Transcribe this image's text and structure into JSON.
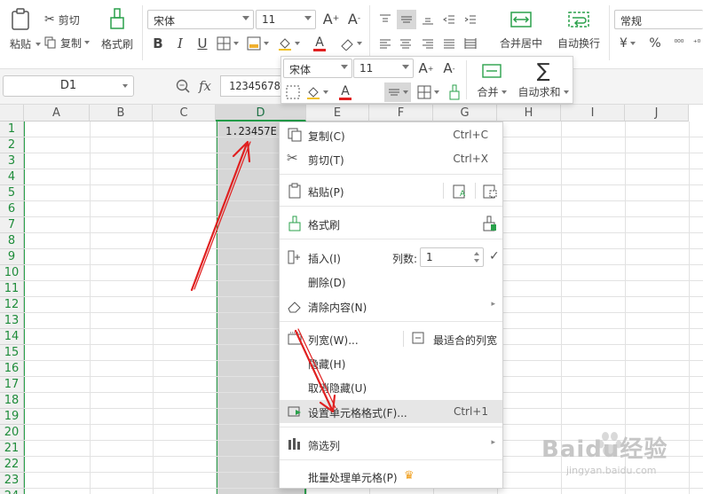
{
  "ribbon": {
    "paste": "粘贴",
    "cut": "剪切",
    "copy": "复制",
    "format_painter": "格式刷",
    "font_name": "宋体",
    "font_size": "11",
    "merge_center": "合并居中",
    "wrap_text": "自动换行",
    "number_format": "常规",
    "currency_symbol": "¥",
    "percent_symbol": "%"
  },
  "formula_bar": {
    "name_box": "D1",
    "fx": "fx",
    "value": "12345678"
  },
  "grid": {
    "columns": [
      "A",
      "B",
      "C",
      "D",
      "E",
      "F",
      "G",
      "H",
      "I",
      "J"
    ],
    "rows": [
      "1",
      "2",
      "3",
      "4",
      "5",
      "6",
      "7",
      "8",
      "9",
      "10",
      "11",
      "12",
      "13",
      "14",
      "15",
      "16",
      "17",
      "18",
      "19",
      "20",
      "21",
      "22",
      "23",
      "24"
    ],
    "active_column": "D",
    "cell_D1": "1.23457E"
  },
  "mini_toolbar": {
    "font_name": "宋体",
    "font_size": "11",
    "merge": "合并",
    "autosum": "自动求和"
  },
  "context_menu": {
    "copy": "复制(C)",
    "copy_shortcut": "Ctrl+C",
    "cut": "剪切(T)",
    "cut_shortcut": "Ctrl+X",
    "paste": "粘贴(P)",
    "format_painter": "格式刷",
    "insert": "插入(I)",
    "column_count_label": "列数:",
    "column_count": "1",
    "delete": "删除(D)",
    "clear": "清除内容(N)",
    "col_width": "列宽(W)...",
    "best_fit": "最适合的列宽",
    "hide": "隐藏(H)",
    "unhide": "取消隐藏(U)",
    "format_cells": "设置单元格格式(F)...",
    "format_cells_shortcut": "Ctrl+1",
    "filter": "筛选列",
    "batch": "批量处理单元格(P)"
  },
  "watermark": {
    "brand": "Baidu经验",
    "url": "jingyan.baidu.com"
  },
  "colors": {
    "accent_green": "#2aa14b",
    "annotation_red": "#e02020",
    "font_color_red": "#e02020"
  }
}
